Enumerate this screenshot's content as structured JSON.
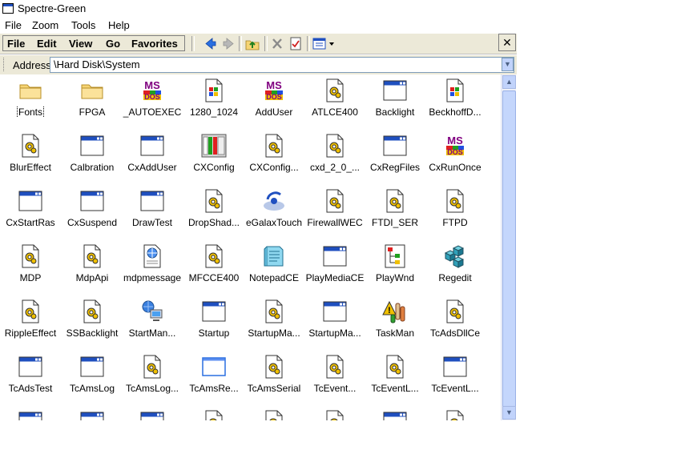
{
  "window": {
    "title": "Spectre-Green"
  },
  "menu": [
    "File",
    "Zoom",
    "Tools",
    "Help"
  ],
  "command_bar": [
    "File",
    "Edit",
    "View",
    "Go",
    "Favorites"
  ],
  "address": {
    "label": "Address",
    "value": "\\Hard Disk\\System"
  },
  "close_glyph": "✕",
  "scroll_up": "▲",
  "scroll_down": "▼",
  "addr_dropdown": "▼",
  "icons_legend": {
    "folder": "folder-icon",
    "msdos": "msdos-icon",
    "exe": "executable-icon",
    "app": "application-window-icon",
    "gear": "gear-document-icon",
    "tablet": "tablet-icon",
    "globe": "globe-document-icon",
    "touch": "touch-icon",
    "notepad": "notepad-icon",
    "tree": "tree-structure-icon",
    "regedit": "registry-cubes-icon",
    "network": "network-computer-icon",
    "warn": "warning-task-icon",
    "blank": "blank-window-icon"
  },
  "files": [
    {
      "name": "Fonts",
      "icon": "folder"
    },
    {
      "name": "FPGA",
      "icon": "folder"
    },
    {
      "name": "_AUTOEXEC",
      "icon": "msdos"
    },
    {
      "name": "1280_1024",
      "icon": "exe"
    },
    {
      "name": "AddUser",
      "icon": "msdos"
    },
    {
      "name": "ATLCE400",
      "icon": "gear"
    },
    {
      "name": "Backlight",
      "icon": "app"
    },
    {
      "name": "BeckhoffD...",
      "icon": "exe"
    },
    {
      "name": "BlurEffect",
      "icon": "gear"
    },
    {
      "name": "Calbration",
      "icon": "app"
    },
    {
      "name": "CxAddUser",
      "icon": "app"
    },
    {
      "name": "CXConfig",
      "icon": "tablet"
    },
    {
      "name": "CXConfig...",
      "icon": "gear"
    },
    {
      "name": "cxd_2_0_...",
      "icon": "gear"
    },
    {
      "name": "CxRegFiles",
      "icon": "app"
    },
    {
      "name": "CxRunOnce",
      "icon": "msdos"
    },
    {
      "name": "CxStartRas",
      "icon": "app"
    },
    {
      "name": "CxSuspend",
      "icon": "app"
    },
    {
      "name": "DrawTest",
      "icon": "app"
    },
    {
      "name": "DropShad...",
      "icon": "gear"
    },
    {
      "name": "eGalaxTouch",
      "icon": "touch"
    },
    {
      "name": "FirewallWEC",
      "icon": "gear"
    },
    {
      "name": "FTDI_SER",
      "icon": "gear"
    },
    {
      "name": "FTPD",
      "icon": "gear"
    },
    {
      "name": "MDP",
      "icon": "gear"
    },
    {
      "name": "MdpApi",
      "icon": "gear"
    },
    {
      "name": "mdpmessage",
      "icon": "globe"
    },
    {
      "name": "MFCCE400",
      "icon": "gear"
    },
    {
      "name": "NotepadCE",
      "icon": "notepad"
    },
    {
      "name": "PlayMediaCE",
      "icon": "app"
    },
    {
      "name": "PlayWnd",
      "icon": "tree"
    },
    {
      "name": "Regedit",
      "icon": "regedit"
    },
    {
      "name": "RippleEffect",
      "icon": "gear"
    },
    {
      "name": "SSBacklight",
      "icon": "gear"
    },
    {
      "name": "StartMan...",
      "icon": "network"
    },
    {
      "name": "Startup",
      "icon": "app"
    },
    {
      "name": "StartupMa...",
      "icon": "gear"
    },
    {
      "name": "StartupMa...",
      "icon": "app"
    },
    {
      "name": "TaskMan",
      "icon": "warn"
    },
    {
      "name": "TcAdsDllCe",
      "icon": "gear"
    },
    {
      "name": "TcAdsTest",
      "icon": "app"
    },
    {
      "name": "TcAmsLog",
      "icon": "app"
    },
    {
      "name": "TcAmsLog...",
      "icon": "gear"
    },
    {
      "name": "TcAmsRe...",
      "icon": "blank"
    },
    {
      "name": "TcAmsSerial",
      "icon": "gear"
    },
    {
      "name": "TcEvent...",
      "icon": "gear"
    },
    {
      "name": "TcEventL...",
      "icon": "gear"
    },
    {
      "name": "TcEventL...",
      "icon": "app"
    },
    {
      "name": "",
      "icon": "app"
    },
    {
      "name": "",
      "icon": "app"
    },
    {
      "name": "",
      "icon": "app"
    },
    {
      "name": "",
      "icon": "gear"
    },
    {
      "name": "",
      "icon": "gear"
    },
    {
      "name": "",
      "icon": "gear"
    },
    {
      "name": "",
      "icon": "app"
    },
    {
      "name": "",
      "icon": "gear"
    }
  ],
  "colors": {
    "window_blue": "#1f4fbf",
    "folder_yellow": "#f6d473",
    "toolbar_bg": "#ece9d8"
  }
}
